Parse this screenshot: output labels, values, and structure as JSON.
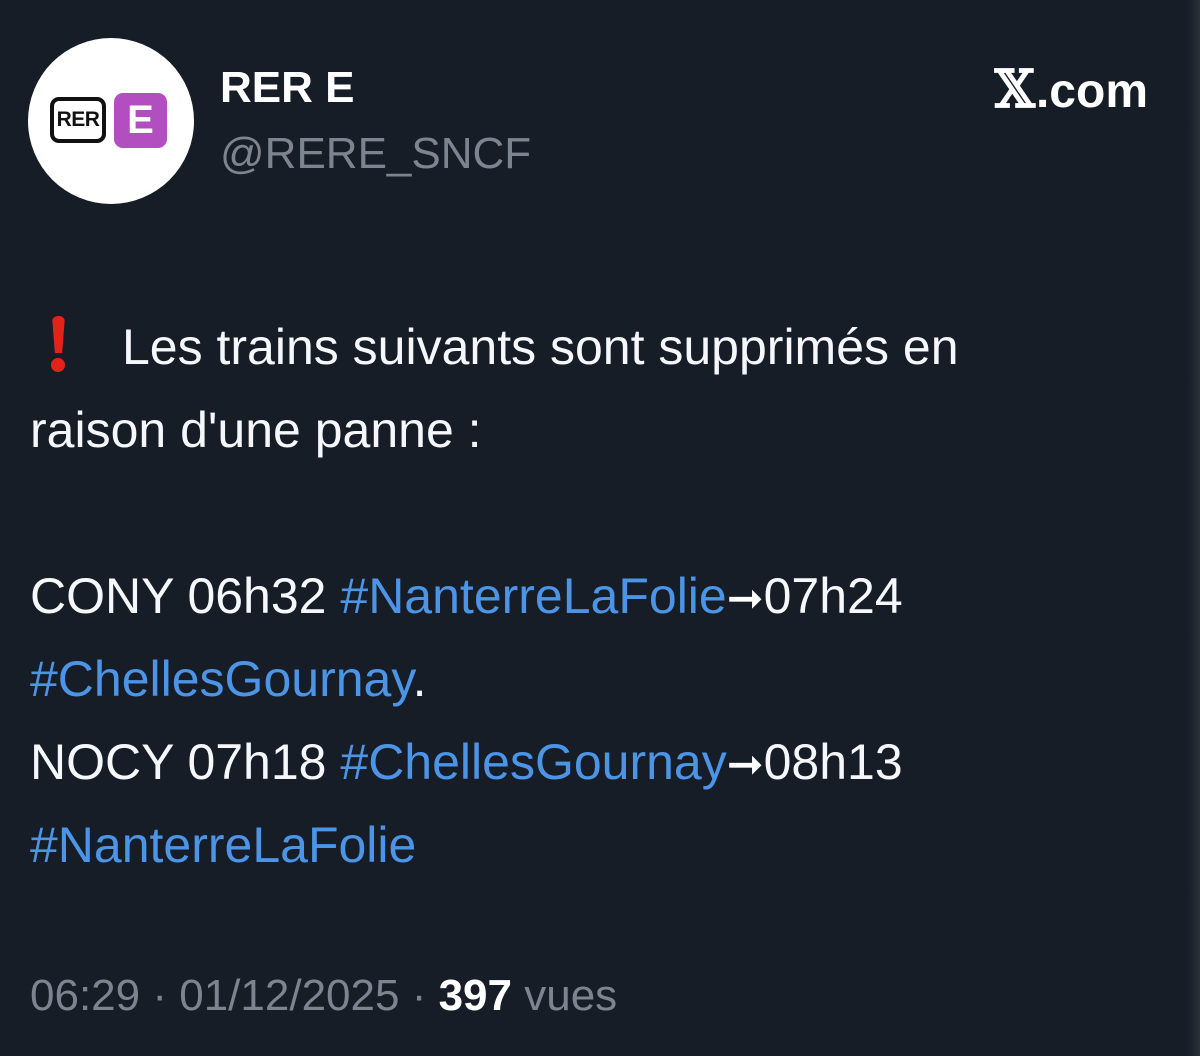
{
  "author": {
    "display_name": "RER E",
    "handle": "@RERE_SNCF",
    "avatar": {
      "badge_text": "RER",
      "line_letter": "E",
      "line_color": "#b24ec0"
    }
  },
  "platform": {
    "icon": "x-logo-icon",
    "glyph": "𝕏",
    "label": ".com"
  },
  "tweet": {
    "alert_icon": "red-exclamation-icon",
    "intro_line1": "Les trains suivants sont supprimés en",
    "intro_line2": "raison d'une panne :",
    "trains": [
      {
        "code_time": "CONY 06h32",
        "origin_tag": "#NanterreLaFolie",
        "arrow": "➞",
        "arrival": "07h24",
        "destination_tag": "#ChellesGournay",
        "suffix": "."
      },
      {
        "code_time": "NOCY 07h18",
        "origin_tag": "#ChellesGournay",
        "arrow": "➞",
        "arrival": "08h13",
        "destination_tag": "#NanterreLaFolie",
        "suffix": ""
      }
    ],
    "hashtag_color": "#4c94e6"
  },
  "meta": {
    "time": "06:29",
    "separator": "·",
    "date": "01/12/2025",
    "views_count": "397",
    "views_label": "vues"
  }
}
